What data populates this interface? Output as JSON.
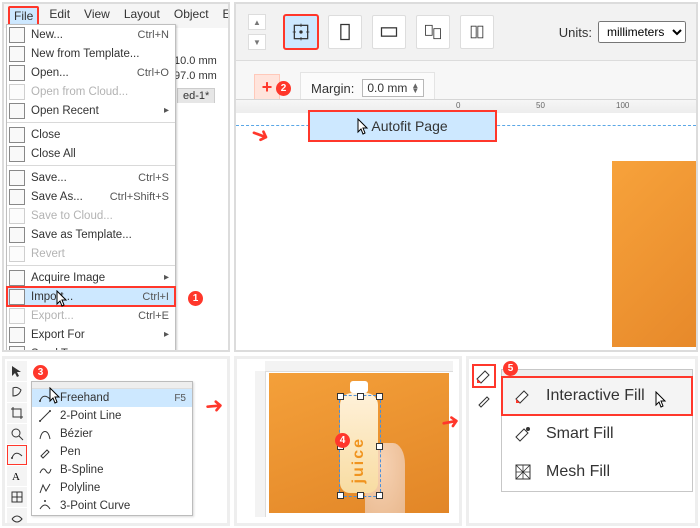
{
  "p1": {
    "menubar": [
      "File",
      "Edit",
      "View",
      "Layout",
      "Object",
      "Ef"
    ],
    "items": [
      {
        "ic": "new",
        "label": "New...",
        "shortcut": "Ctrl+N"
      },
      {
        "ic": "tmpl",
        "label": "New from Template..."
      },
      {
        "ic": "open",
        "label": "Open...",
        "shortcut": "Ctrl+O"
      },
      {
        "ic": "cloud",
        "label": "Open from Cloud...",
        "disabled": true
      },
      {
        "ic": "recent",
        "label": "Open Recent",
        "arrow": true
      },
      {
        "sep": true
      },
      {
        "ic": "close",
        "label": "Close"
      },
      {
        "ic": "closeall",
        "label": "Close All"
      },
      {
        "sep": true
      },
      {
        "ic": "save",
        "label": "Save...",
        "shortcut": "Ctrl+S"
      },
      {
        "ic": "saveas",
        "label": "Save As...",
        "shortcut": "Ctrl+Shift+S"
      },
      {
        "ic": "savecloud",
        "label": "Save to Cloud...",
        "disabled": true
      },
      {
        "ic": "savetmpl",
        "label": "Save as Template..."
      },
      {
        "ic": "revert",
        "label": "Revert",
        "disabled": true
      },
      {
        "sep": true
      },
      {
        "ic": "scan",
        "label": "Acquire Image",
        "arrow": true
      },
      {
        "ic": "import",
        "label": "Import...",
        "shortcut": "Ctrl+I",
        "hi": true
      },
      {
        "ic": "export",
        "label": "Export...",
        "shortcut": "Ctrl+E",
        "disabled": true
      },
      {
        "ic": "exportfor",
        "label": "Export For",
        "arrow": true
      },
      {
        "ic": "sendto",
        "label": "Send To",
        "arrow": true
      }
    ],
    "dim1": "10.0 mm",
    "dim2": "97.0 mm",
    "tab": "ed-1*"
  },
  "p2": {
    "units_label": "Units:",
    "units_value": "millimeters",
    "margin_label": "Margin:",
    "margin_value": "0.0 mm",
    "autofit": "Autofit Page",
    "ruler": [
      "0",
      "50",
      "100"
    ]
  },
  "p3": {
    "tools": [
      {
        "n": "pick"
      },
      {
        "n": "shape"
      },
      {
        "n": "crop"
      },
      {
        "n": "zoom"
      },
      {
        "n": "freehand",
        "red": true
      },
      {
        "n": "text"
      },
      {
        "n": "table"
      },
      {
        "n": "artistic"
      }
    ],
    "fly": [
      {
        "ic": "freehand",
        "label": "Freehand",
        "sc": "F5",
        "hi": true
      },
      {
        "ic": "line2",
        "label": "2-Point Line"
      },
      {
        "ic": "bezier",
        "label": "Bézier"
      },
      {
        "ic": "pen",
        "label": "Pen"
      },
      {
        "ic": "bspline",
        "label": "B-Spline"
      },
      {
        "ic": "polyline",
        "label": "Polyline"
      },
      {
        "ic": "curve3",
        "label": "3-Point Curve"
      }
    ]
  },
  "p4": {
    "bottle": "juice"
  },
  "p5": {
    "items": [
      {
        "ic": "ifill",
        "label": "Interactive Fill",
        "hi": true
      },
      {
        "ic": "sfill",
        "label": "Smart Fill"
      },
      {
        "ic": "mfill",
        "label": "Mesh Fill"
      }
    ]
  }
}
